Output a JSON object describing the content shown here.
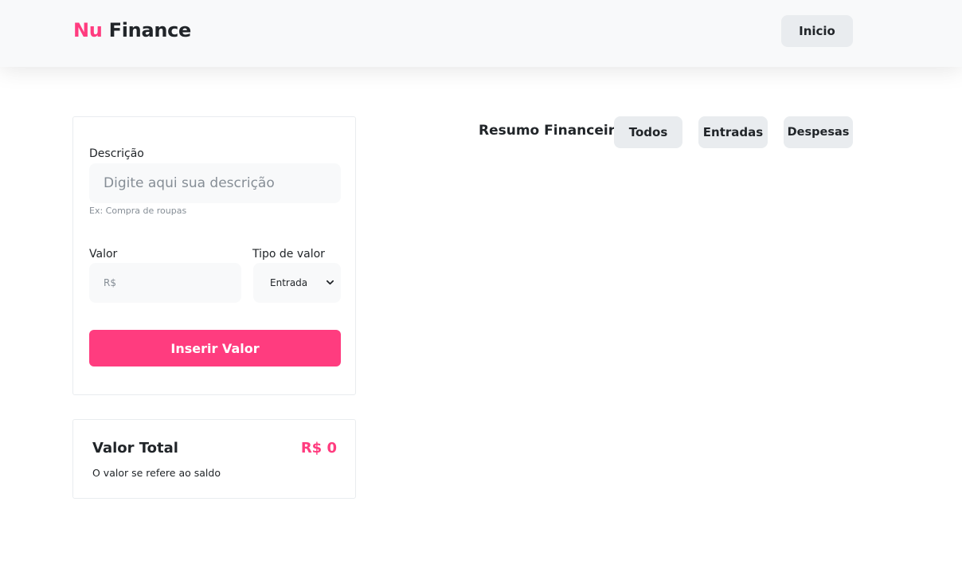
{
  "brand": {
    "part1": "Nu",
    "part2": "Finance"
  },
  "nav": {
    "home_label": "Inicio"
  },
  "form": {
    "description_label": "Descrição",
    "description_placeholder": "Digite aqui sua descrição",
    "description_hint": "Ex: Compra de roupas",
    "value_label": "Valor",
    "value_placeholder": "R$",
    "type_label": "Tipo de valor",
    "type_selected": "Entrada",
    "submit_label": "Inserir Valor"
  },
  "total": {
    "title": "Valor Total",
    "amount": "R$ 0",
    "subtitle": "O valor se refere ao saldo"
  },
  "summary": {
    "title": "Resumo Financeiro",
    "filters": [
      "Todos",
      "Entradas",
      "Despesas"
    ]
  },
  "colors": {
    "accent": "#ff3c7f",
    "header_bg": "#f8f9fa",
    "button_gray": "#e9ecef"
  }
}
